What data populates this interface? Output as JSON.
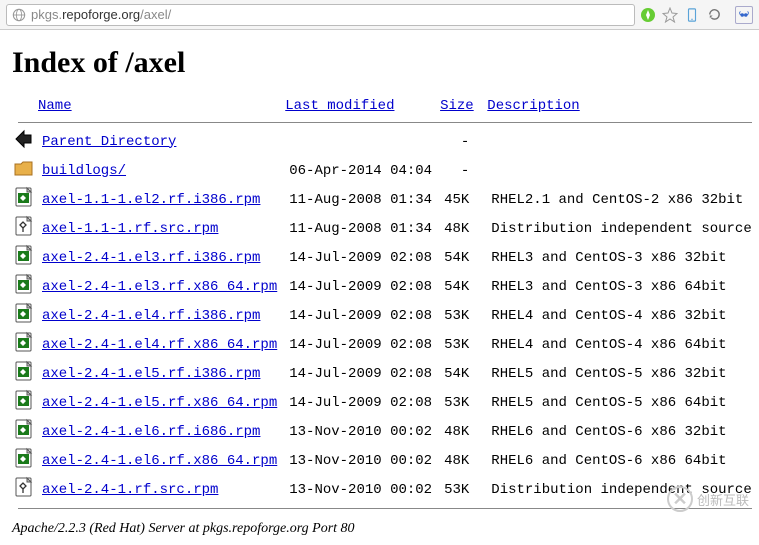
{
  "url": {
    "prefix": "pkgs.",
    "host": "repoforge.org",
    "path": "/axel/"
  },
  "heading": "Index of /axel",
  "columns": {
    "name": "Name",
    "modified": "Last modified",
    "size": "Size",
    "description": "Description"
  },
  "parent": {
    "label": "Parent Directory",
    "size": "-"
  },
  "rows": [
    {
      "icon": "folder",
      "name": " buildlogs/",
      "modified": "06-Apr-2014 04:04",
      "size": "-",
      "desc": ""
    },
    {
      "icon": "rpm",
      "name": "axel-1.1-1.el2.rf.i386.rpm",
      "modified": "11-Aug-2008 01:34",
      "size": "45K",
      "desc": "RHEL2.1 and CentOS-2 x86 32bit"
    },
    {
      "icon": "src",
      "name": "axel-1.1-1.rf.src.rpm",
      "modified": "11-Aug-2008 01:34",
      "size": "48K",
      "desc": "Distribution independent source"
    },
    {
      "icon": "rpm",
      "name": "axel-2.4-1.el3.rf.i386.rpm",
      "modified": "14-Jul-2009 02:08",
      "size": "54K",
      "desc": "RHEL3 and CentOS-3 x86 32bit"
    },
    {
      "icon": "rpm",
      "name": "axel-2.4-1.el3.rf.x86_64.rpm",
      "modified": "14-Jul-2009 02:08",
      "size": "54K",
      "desc": "RHEL3 and CentOS-3 x86 64bit"
    },
    {
      "icon": "rpm",
      "name": "axel-2.4-1.el4.rf.i386.rpm",
      "modified": "14-Jul-2009 02:08",
      "size": "53K",
      "desc": "RHEL4 and CentOS-4 x86 32bit"
    },
    {
      "icon": "rpm",
      "name": "axel-2.4-1.el4.rf.x86_64.rpm",
      "modified": "14-Jul-2009 02:08",
      "size": "53K",
      "desc": "RHEL4 and CentOS-4 x86 64bit"
    },
    {
      "icon": "rpm",
      "name": "axel-2.4-1.el5.rf.i386.rpm",
      "modified": "14-Jul-2009 02:08",
      "size": "54K",
      "desc": "RHEL5 and CentOS-5 x86 32bit"
    },
    {
      "icon": "rpm",
      "name": "axel-2.4-1.el5.rf.x86_64.rpm",
      "modified": "14-Jul-2009 02:08",
      "size": "53K",
      "desc": "RHEL5 and CentOS-5 x86 64bit"
    },
    {
      "icon": "rpm",
      "name": "axel-2.4-1.el6.rf.i686.rpm",
      "modified": "13-Nov-2010 00:02",
      "size": "48K",
      "desc": "RHEL6 and CentOS-6 x86 32bit"
    },
    {
      "icon": "rpm",
      "name": "axel-2.4-1.el6.rf.x86_64.rpm",
      "modified": "13-Nov-2010 00:02",
      "size": "48K",
      "desc": "RHEL6 and CentOS-6 x86 64bit"
    },
    {
      "icon": "src",
      "name": "axel-2.4-1.rf.src.rpm",
      "modified": "13-Nov-2010 00:02",
      "size": "53K",
      "desc": "Distribution independent source"
    }
  ],
  "footer": "Apache/2.2.3 (Red Hat) Server at pkgs.repoforge.org Port 80",
  "watermark": "创新互联"
}
